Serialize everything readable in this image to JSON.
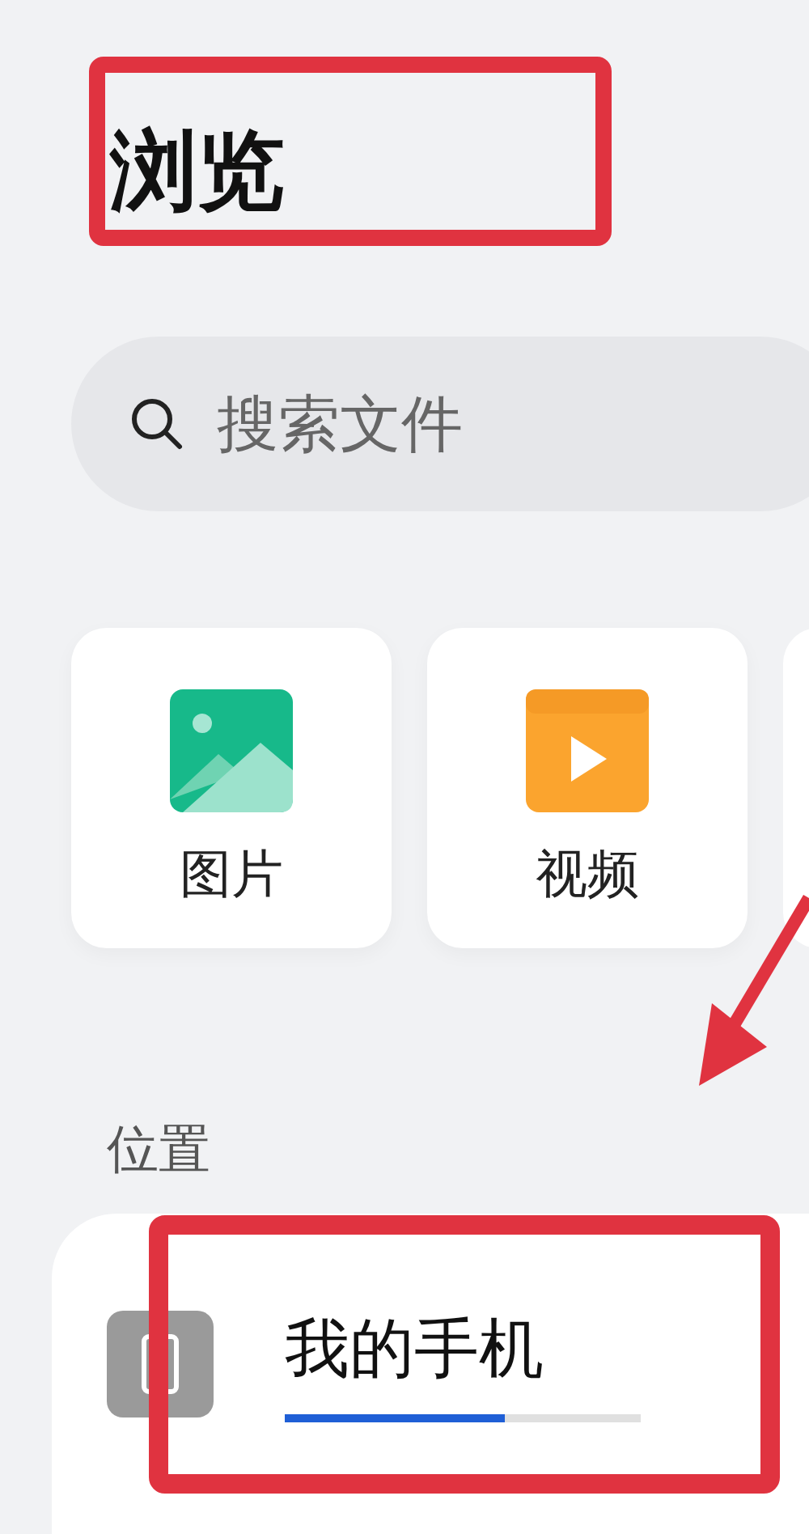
{
  "title": "浏览",
  "search": {
    "placeholder": "搜索文件"
  },
  "categories": [
    {
      "kind": "image",
      "label": "图片"
    },
    {
      "kind": "video",
      "label": "视频"
    }
  ],
  "locations": {
    "heading": "位置",
    "items": [
      {
        "name": "我的手机",
        "level": 0.62
      }
    ]
  }
}
